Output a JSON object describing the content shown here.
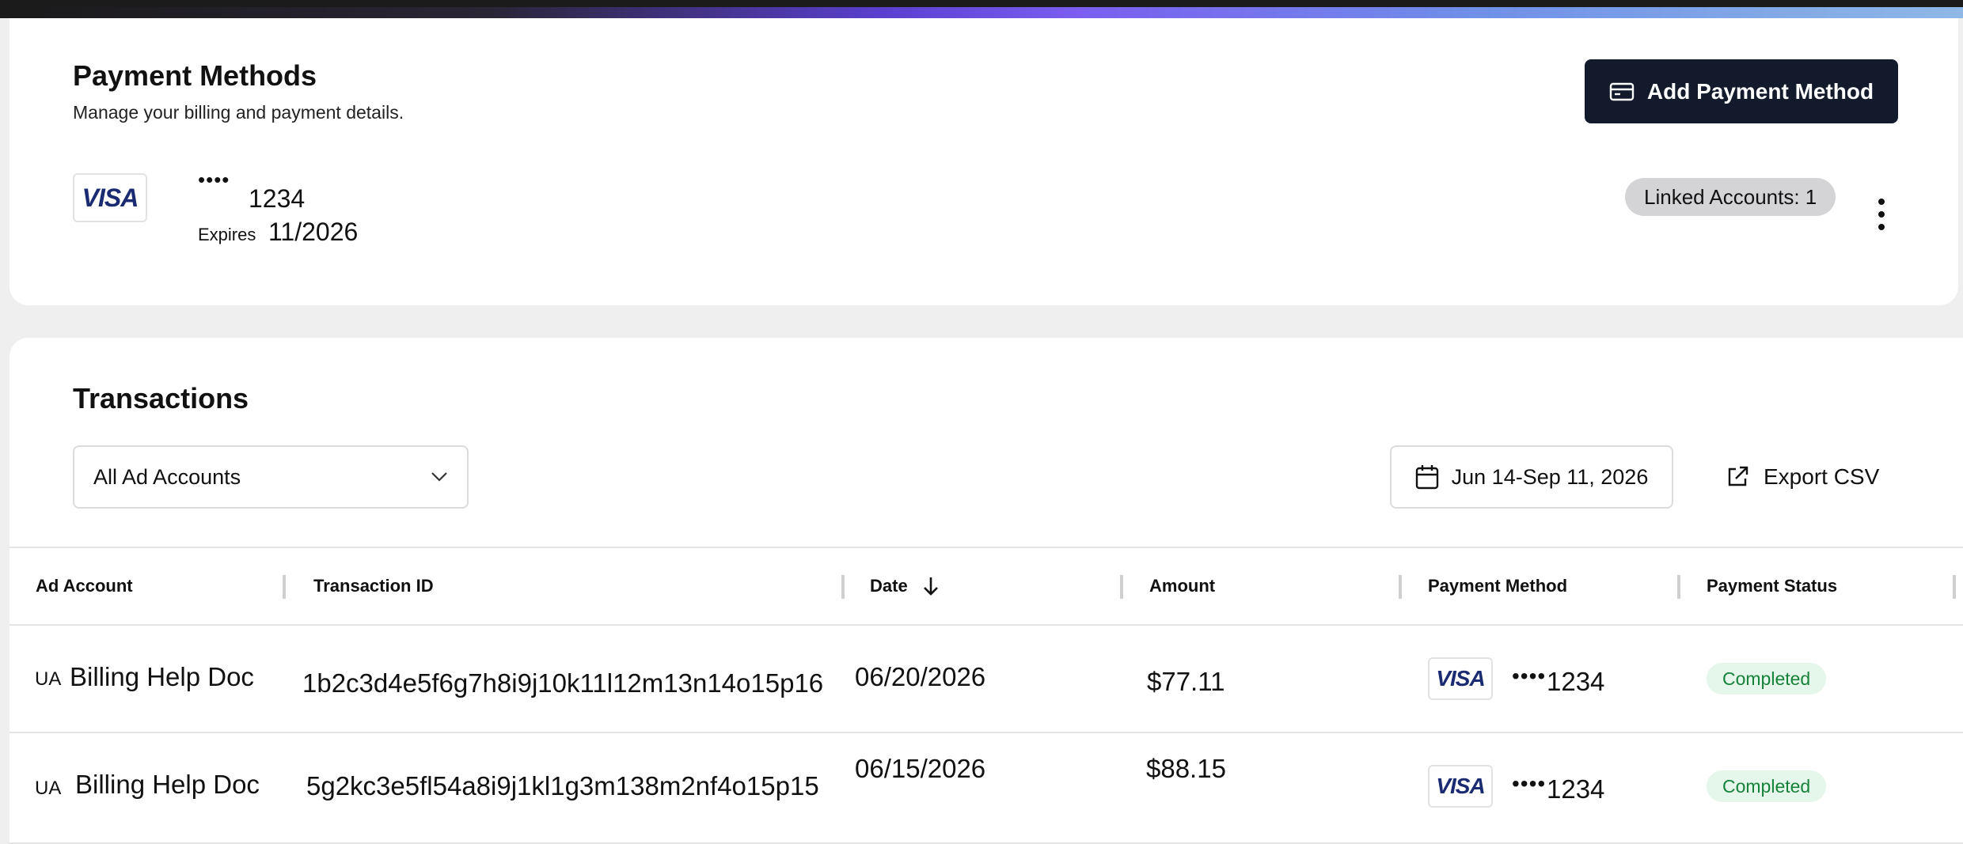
{
  "payment_methods": {
    "title": "Payment Methods",
    "subtitle": "Manage your billing and payment details.",
    "add_button_label": "Add Payment Method",
    "card": {
      "brand": "VISA",
      "masked": "••••",
      "last4": "1234",
      "expires_label": "Expires",
      "expires_value": "11/2026",
      "linked_accounts": "Linked Accounts: 1"
    }
  },
  "transactions": {
    "title": "Transactions",
    "account_filter": "All Ad Accounts",
    "date_range": "Jun 14-Sep 11, 2026",
    "export_label": "Export CSV",
    "columns": [
      "Ad Account",
      "Transaction ID",
      "Date",
      "Amount",
      "Payment Method",
      "Payment Status"
    ],
    "rows": [
      {
        "prefix": "UA",
        "account": "Billing Help Doc",
        "transaction_id": "1b2c3d4e5f6g7h8i9j10k11l12m13n14o15p16",
        "date": "06/20/2026",
        "amount": "$77.11",
        "brand": "VISA",
        "masked": "••••",
        "last4": "1234",
        "status": "Completed"
      },
      {
        "prefix": "UA",
        "account": "Billing Help Doc",
        "transaction_id": "5g2kc3e5fl54a8i9j1kl1g3m138m2nf4o15p15",
        "date": "06/15/2026",
        "amount": "$88.15",
        "brand": "VISA",
        "masked": "••••",
        "last4": "1234",
        "status": "Completed"
      }
    ]
  },
  "colors": {
    "primary_button": "#121a2c",
    "visa_blue": "#1a2b72",
    "status_completed_bg": "#e5f6ea",
    "status_completed_text": "#16823a",
    "linked_badge_bg": "#d4d4d6"
  },
  "icons": {
    "add_button": "credit-card-icon",
    "account_filter": "chevron-down-icon",
    "date_range": "calendar-icon",
    "export": "external-link-icon",
    "sort": "arrow-down-icon",
    "more": "kebab-menu-icon"
  }
}
